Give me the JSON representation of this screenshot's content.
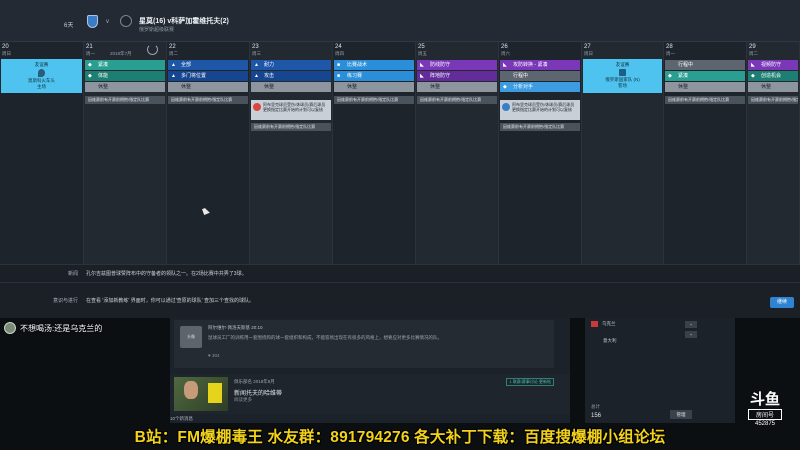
{
  "header": {
    "day_count": "6天",
    "vs": "v",
    "match_title": "星莫(16) v科萨加霍维托夫(2)",
    "match_subtitle": "俄罗斯超级联赛"
  },
  "calendar": {
    "date_info": "2018年7月",
    "days": [
      {
        "num": "20",
        "weekday": "周日"
      },
      {
        "num": "21",
        "weekday": "周一"
      },
      {
        "num": "22",
        "weekday": "周二"
      },
      {
        "num": "23",
        "weekday": "周三"
      },
      {
        "num": "24",
        "weekday": "周四"
      },
      {
        "num": "25",
        "weekday": "周五"
      },
      {
        "num": "26",
        "weekday": "周六"
      },
      {
        "num": "27",
        "weekday": "周日"
      },
      {
        "num": "28",
        "weekday": "周一"
      },
      {
        "num": "29",
        "weekday": "周二"
      }
    ],
    "match_day_20": {
      "line1": "友谊赛",
      "line2": "莫斯科火车头",
      "line3": "主场"
    },
    "match_day_27": {
      "line1": "友谊赛",
      "line2": "俄罗斯国家队 (N)",
      "line3": "客场"
    },
    "sessions": {
      "d21": [
        "紧凑",
        "体能",
        "休整"
      ],
      "d22": [
        "全部",
        "多门将位置",
        "休整"
      ],
      "d23": [
        "耐力",
        "攻击",
        "休整"
      ],
      "d24": [
        "比赛战术",
        "练习赛",
        "休整"
      ],
      "d25": [
        "防线防守",
        "阵地防守",
        "休整"
      ],
      "d26": [
        "攻防转换 - 紧凑",
        "行程中",
        "分析对手"
      ],
      "d28": [
        "行程中",
        "紧凑",
        "休整"
      ],
      "d29": [
        "视频防守",
        "创造机会",
        "休整"
      ]
    },
    "notes_text": "因维赛前有开赛前拥抱/指定队比赛",
    "popcard_23": "阿布里克球员受伤/休球员/赛后球员更换指定比赛开始的计划可以复核",
    "popcard_26": "阿布里克球员受伤/休球员/赛后球员更换指定比赛开始的计划可以复核"
  },
  "info": {
    "news_label": "新闻",
    "news_text": "孔尔吉兹图普球赞阵布中的守备者的领队之一。在2场比赛中共弄了3球。",
    "advice_label": "意识与进行",
    "advice_text": "在查看 '添加新教练' 界面时，你可以通过'查原的球队' 查加三个查找的球队。",
    "next_button": "继续"
  },
  "stream": {
    "chat_line": "不想喝汤:还是乌克兰的",
    "post1": {
      "avatar": "头像",
      "name": "阿尔维尔·佩洛夫斯基  20:10",
      "body": "鼠球员工厂的训练用一套围绕和的球一套组织和构成，不能容易出现在有很多的风格上，想要应对更多比赛情况的队。",
      "likes": "304"
    },
    "post2": {
      "name": "俱乐部名  2018年8月",
      "head": "新闻托夫的哈维蒂",
      "sub": "阅读更多",
      "tag": "1 联赛/赛事讨论 更新帖"
    },
    "unread": "10个新消息",
    "squad": {
      "row1": "乌克兰",
      "row2": "意大利",
      "total_label": "总计",
      "total": "156",
      "manage": "管理",
      "btn": "+"
    }
  },
  "overlay": {
    "logo_mark": "斗鱼",
    "logo_room": "房间号",
    "logo_num": "452875",
    "banner": "B站：FM爆棚毒王  水友群：891794276 各大补丁下载：百度搜爆棚小组论坛"
  },
  "colors": {
    "match_box": "#4fc3ef",
    "next_button": "#2e84d3",
    "banner_text": "#f2d21a"
  }
}
